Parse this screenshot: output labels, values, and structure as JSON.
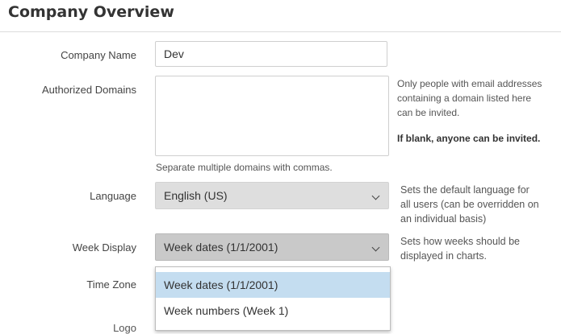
{
  "page": {
    "title": "Company Overview"
  },
  "form": {
    "company_name": {
      "label": "Company Name",
      "value": "Dev"
    },
    "authorized_domains": {
      "label": "Authorized Domains",
      "value": "",
      "help_line1": "Only people with email addresses",
      "help_line2": "containing a domain listed here",
      "help_line3": "can be invited.",
      "help_bold": "If blank, anyone can be invited.",
      "below_hint": "Separate multiple domains with commas."
    },
    "language": {
      "label": "Language",
      "value": "English (US)",
      "help_line1": "Sets the default language for",
      "help_line2": "all users (can be overridden on",
      "help_line3": "an individual basis)"
    },
    "week_display": {
      "label": "Week Display",
      "value": "Week dates (1/1/2001)",
      "help_line1": "Sets how weeks should be",
      "help_line2": "displayed in charts.",
      "options": [
        "Week dates (1/1/2001)",
        "Week numbers (Week 1)"
      ],
      "selected_index": 0
    },
    "time_zone": {
      "label": "Time Zone"
    },
    "logo": {
      "label": "Logo"
    }
  },
  "icons": {
    "select_arrow": "chevron-down-icon"
  },
  "colors": {
    "selected_option": "#c4ddf0",
    "select_bg": "#dedede"
  }
}
